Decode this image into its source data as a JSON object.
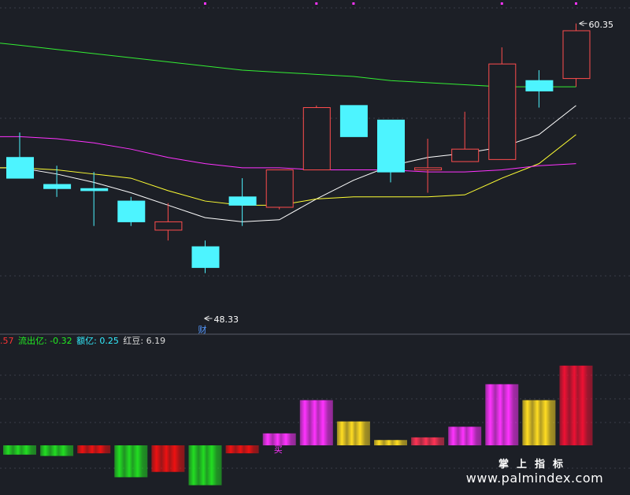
{
  "chart_data": [
    {
      "type": "candlestick",
      "ylim": [
        46.3,
        61.1
      ],
      "candles": [
        {
          "open": 53.9,
          "close": 52.9,
          "high": 55.1,
          "low": 52.9,
          "color": "#4df4ff",
          "fill": true
        },
        {
          "open": 52.6,
          "close": 52.4,
          "high": 53.5,
          "low": 52.0,
          "color": "#4df4ff",
          "fill": true
        },
        {
          "open": 52.4,
          "close": 52.3,
          "high": 53.2,
          "low": 50.6,
          "color": "#4df4ff",
          "fill": true
        },
        {
          "open": 51.8,
          "close": 50.8,
          "high": 52.0,
          "low": 50.6,
          "color": "#4df4ff",
          "fill": true
        },
        {
          "open": 50.4,
          "close": 50.8,
          "high": 51.7,
          "low": 49.9,
          "color": "#ff4d4d",
          "fill": false
        },
        {
          "open": 49.6,
          "close": 48.6,
          "high": 49.9,
          "low": 48.33,
          "color": "#4df4ff",
          "fill": true
        },
        {
          "open": 52.0,
          "close": 51.6,
          "high": 52.9,
          "low": 50.6,
          "color": "#4df4ff",
          "fill": true
        },
        {
          "open": 51.5,
          "close": 53.3,
          "high": 53.3,
          "low": 51.4,
          "color": "#ff4d4d",
          "fill": false
        },
        {
          "open": 53.3,
          "close": 56.3,
          "high": 56.4,
          "low": 53.3,
          "color": "#ff4d4d",
          "fill": false
        },
        {
          "open": 56.4,
          "close": 54.9,
          "high": 56.4,
          "low": 54.9,
          "color": "#4df4ff",
          "fill": true
        },
        {
          "open": 55.7,
          "close": 53.2,
          "high": 55.7,
          "low": 52.7,
          "color": "#4df4ff",
          "fill": true
        },
        {
          "open": 53.3,
          "close": 53.4,
          "high": 54.8,
          "low": 52.2,
          "color": "#ff4d4d",
          "fill": false
        },
        {
          "open": 53.7,
          "close": 54.3,
          "high": 56.1,
          "low": 53.7,
          "color": "#ff4d4d",
          "fill": false
        },
        {
          "open": 53.8,
          "close": 58.4,
          "high": 59.2,
          "low": 53.8,
          "color": "#ff4d4d",
          "fill": false
        },
        {
          "open": 57.6,
          "close": 57.1,
          "high": 58.1,
          "low": 56.3,
          "color": "#4df4ff",
          "fill": true
        },
        {
          "open": 57.7,
          "close": 60.0,
          "high": 60.35,
          "low": 57.3,
          "color": "#ff4d4d",
          "fill": false
        }
      ],
      "ma_lines": [
        {
          "color": "#ffffff",
          "values": [
            53.4,
            53.1,
            52.7,
            52.2,
            51.6,
            51.0,
            50.8,
            50.9,
            51.9,
            52.8,
            53.5,
            53.9,
            54.1,
            54.4,
            55.0,
            56.4
          ]
        },
        {
          "color": "#ffff33",
          "values": [
            53.4,
            53.3,
            53.1,
            52.9,
            52.3,
            51.8,
            51.6,
            51.6,
            51.9,
            52.0,
            52.0,
            52.0,
            52.1,
            52.9,
            53.6,
            55.0
          ]
        },
        {
          "color": "#ff33ff",
          "values": [
            54.9,
            54.8,
            54.6,
            54.3,
            53.9,
            53.6,
            53.4,
            53.4,
            53.3,
            53.3,
            53.3,
            53.2,
            53.2,
            53.3,
            53.5,
            53.6
          ]
        },
        {
          "color": "#33ee33",
          "values": [
            59.3,
            59.1,
            58.9,
            58.7,
            58.5,
            58.3,
            58.1,
            58.0,
            57.9,
            57.8,
            57.6,
            57.5,
            57.4,
            57.3,
            57.3,
            57.3
          ]
        }
      ],
      "annotations": [
        {
          "text": "60.35",
          "candle": 15,
          "value": 60.35
        },
        {
          "text": "48.33",
          "candle": 5,
          "value": 48.33
        },
        {
          "text": "财",
          "candle": 5
        }
      ]
    },
    {
      "type": "bar",
      "ylim": [
        -1.6,
        3.5
      ],
      "values": [
        -0.35,
        -0.4,
        -0.3,
        -1.2,
        -1.0,
        -1.5,
        -0.3,
        0.45,
        1.7,
        0.9,
        0.2,
        0.3,
        0.7,
        2.3,
        1.7,
        3.0
      ],
      "colors": [
        "#22dd22",
        "#22dd22",
        "#ee1111",
        "#22dd22",
        "#ee1111",
        "#22dd22",
        "#ee1111",
        "#ff33ff",
        "#ff33ff",
        "#ffdd22",
        "#ffdd22",
        "#ff3355",
        "#ff33ff",
        "#ff33ff",
        "#ffdd22",
        "#ee1133"
      ],
      "marker": {
        "text": "买",
        "bar": 7
      }
    }
  ],
  "info": {
    "first": ".57",
    "flow_out": "流出亿: -0.32",
    "amount": "额亿: 0.25",
    "red_bean": "红豆: 6.19"
  },
  "watermark": {
    "cn": "掌上指标",
    "url": "www.palmindex.com"
  },
  "top_dots_color": "#ff33ff"
}
